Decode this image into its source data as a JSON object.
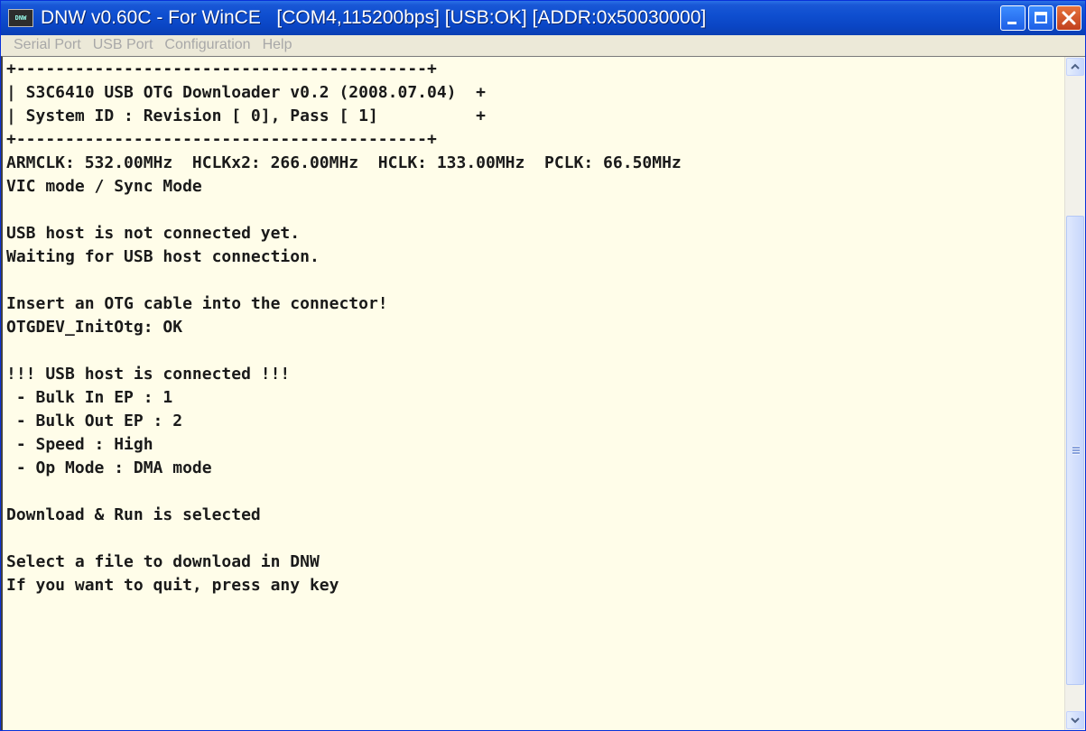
{
  "window": {
    "app_icon_text": "DNW",
    "title": "DNW v0.60C - For WinCE   [COM4,115200bps] [USB:OK] [ADDR:0x50030000]"
  },
  "menu": {
    "items": [
      "Serial Port",
      "USB Port",
      "Configuration",
      "Help"
    ]
  },
  "console": {
    "lines": [
      "+------------------------------------------+",
      "| S3C6410 USB OTG Downloader v0.2 (2008.07.04)  +",
      "| System ID : Revision [ 0], Pass [ 1]          +",
      "+------------------------------------------+",
      "ARMCLK: 532.00MHz  HCLKx2: 266.00MHz  HCLK: 133.00MHz  PCLK: 66.50MHz",
      "VIC mode / Sync Mode",
      "",
      "USB host is not connected yet.",
      "Waiting for USB host connection.",
      "",
      "Insert an OTG cable into the connector!",
      "OTGDEV_InitOtg: OK",
      "",
      "!!! USB host is connected !!!",
      " - Bulk In EP : 1",
      " - Bulk Out EP : 2",
      " - Speed : High",
      " - Op Mode : DMA mode",
      "",
      "Download & Run is selected",
      "",
      "Select a file to download in DNW",
      "If you want to quit, press any key"
    ]
  },
  "icons": {
    "scroll_up": "chevron-up-icon",
    "scroll_down": "chevron-down-icon",
    "minimize": "minimize-icon",
    "maximize": "maximize-icon",
    "close": "close-icon"
  }
}
